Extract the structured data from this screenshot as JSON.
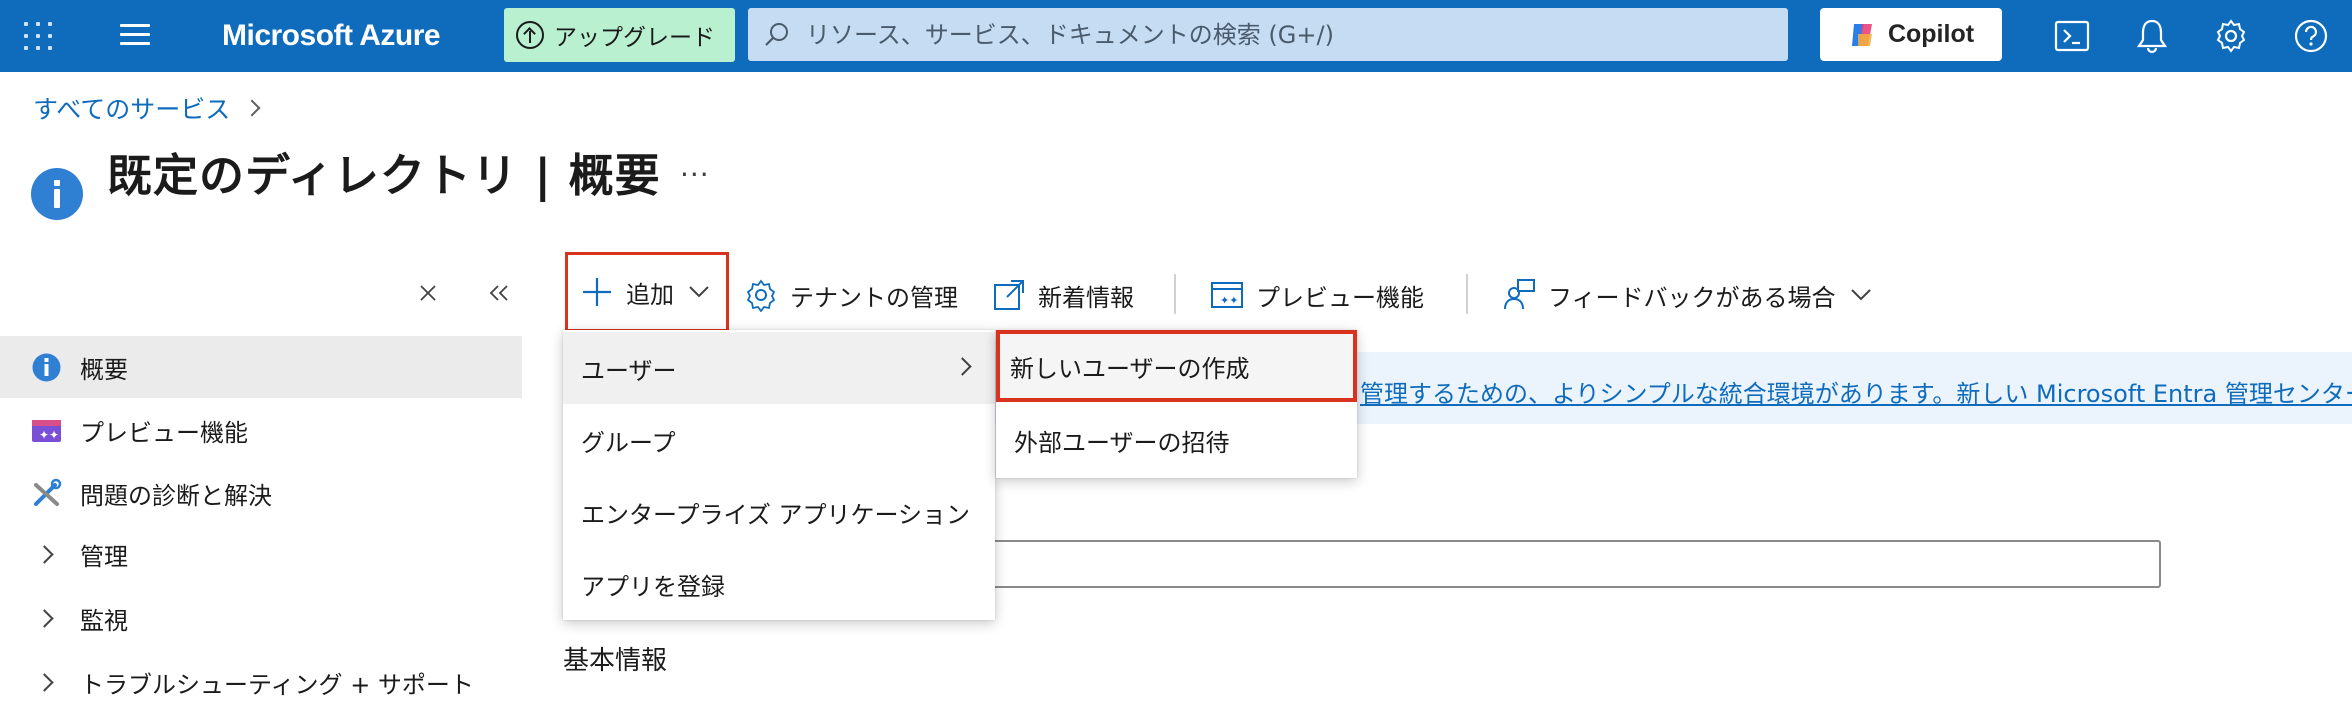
{
  "topbar": {
    "brand": "Microsoft Azure",
    "upgrade_label": "アップグレード",
    "search_placeholder": "リソース、サービス、ドキュメントの検索 (G+/)",
    "copilot_label": "Copilot",
    "icons": [
      "waffle-icon",
      "menu-icon",
      "upgrade-icon",
      "search-icon",
      "copilot-icon",
      "cloud-shell-icon",
      "bell-icon",
      "gear-icon",
      "help-icon"
    ],
    "colors": {
      "bar": "#0f6cbd",
      "upgrade_bg": "#b8f0d0",
      "search_bg": "#c6dcf3"
    }
  },
  "breadcrumb": {
    "items": [
      "すべてのサービス"
    ]
  },
  "page": {
    "title": "既定のディレクトリ | 概要",
    "more": "···"
  },
  "sidebar": {
    "controls": {
      "clear": "✕",
      "collapse": "«"
    },
    "items": [
      {
        "label": "概要",
        "icon": "info-icon",
        "selected": true
      },
      {
        "label": "プレビュー機能",
        "icon": "preview-features-icon"
      },
      {
        "label": "問題の診断と解決",
        "icon": "wrench-icon"
      },
      {
        "label": "管理",
        "icon": "chevron-right-icon"
      },
      {
        "label": "監視",
        "icon": "chevron-right-icon"
      },
      {
        "label": "トラブルシューティング + サポート",
        "icon": "chevron-right-icon"
      }
    ]
  },
  "commandbar": {
    "add": "追加",
    "tenant": "テナントの管理",
    "whats_new": "新着情報",
    "preview": "プレビュー機能",
    "feedback": "フィードバックがある場合"
  },
  "banner": {
    "link_text": "管理するための、よりシンプルな統合環境があります。新しい Microsoft Entra 管理センター"
  },
  "content": {
    "section_title": "基本情報"
  },
  "add_menu": {
    "items": [
      "ユーザー",
      "グループ",
      "エンタープライズ アプリケーション",
      "アプリを登録"
    ]
  },
  "user_submenu": {
    "items": [
      "新しいユーザーの作成",
      "外部ユーザーの招待"
    ]
  },
  "accent": {
    "highlight_border": "#d9331f",
    "link": "#0f6cbd"
  }
}
